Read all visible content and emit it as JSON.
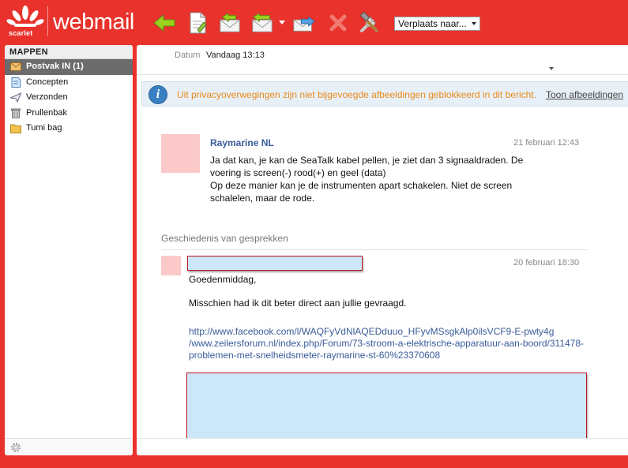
{
  "app": {
    "logo_text": "scarlet",
    "brand": "webmail"
  },
  "toolbar": {
    "move_select": "Verplaats naar...",
    "icons": [
      "back-arrow-icon",
      "new-message-icon",
      "reply-icon",
      "reply-all-icon",
      "forward-icon",
      "delete-icon",
      "tools-icon"
    ]
  },
  "sidebar": {
    "header": "MAPPEN",
    "folders": [
      {
        "label": "Postvak IN (1)",
        "icon": "inbox-icon",
        "active": true
      },
      {
        "label": "Concepten",
        "icon": "drafts-icon",
        "active": false
      },
      {
        "label": "Verzonden",
        "icon": "sent-icon",
        "active": false
      },
      {
        "label": "Prullenbak",
        "icon": "trash-icon",
        "active": false
      },
      {
        "label": "Tumi bag",
        "icon": "folder-icon",
        "active": false
      }
    ]
  },
  "message": {
    "datum_label": "Datum",
    "datum_value": "Vandaag 13:13",
    "privacy_notice": "Uit privacyoverwegingen zijn niet bijgevoegde afbeeldingen geblokkeerd in dit bericht.",
    "show_images": "Toon afbeeldingen",
    "sender": "Raymarine NL",
    "date": "21 februari 12:43",
    "body_lines": [
      "Ja dat kan, je kan de SeaTalk kabel pellen, je ziet dan 3 signaaldraden. De",
      "voering is screen(-) rood(+) en geel (data)",
      "Op deze manier kan je de instrumenten apart schakelen. Niet de screen",
      "schalelen, maar de rode."
    ]
  },
  "history": {
    "label": "Geschiedenis van gesprekken",
    "date": "20 februari 18:30",
    "greeting": "Goedenmiddag,",
    "text": "Misschien had ik dit beter direct aan jullie gevraagd.",
    "link_lines": [
      "http://www.facebook.com/l/WAQFyVdNlAQEDduuo_HFyvMSsgkAlp0ilsVCF9-E-pwty4g",
      "/www.zeilersforum.nl/index.php/Forum/73-stroom-a-elektrische-apparatuur-aan-boord/311478-",
      "problemen-met-snelheidsmeter-raymarine-st-60%23370608"
    ]
  },
  "colors": {
    "brand_red": "#e8322b",
    "link_blue": "#3a5b99",
    "notice_orange": "#e88a1a",
    "redaction_fill": "#cce8f8",
    "redaction_border": "#c0141d",
    "avatar_placeholder": "#fbc9c9"
  }
}
